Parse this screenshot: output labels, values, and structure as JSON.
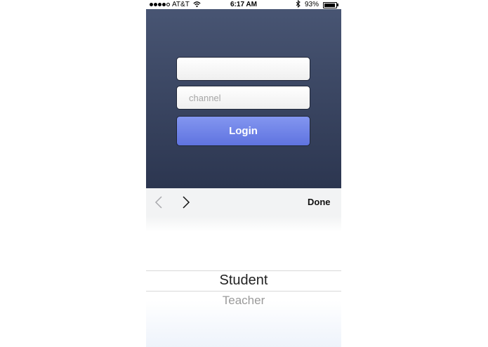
{
  "status_bar": {
    "carrier": "AT&T",
    "time": "6:17 AM",
    "battery": "93%",
    "battery_level": 0.93,
    "bluetooth_icon": "bluetooth-icon",
    "wifi_icon": "wifi-icon"
  },
  "login": {
    "username_value": "",
    "channel_placeholder": "channel",
    "login_label": "Login",
    "colors": {
      "background_top": "#485573",
      "background_bottom": "#2c3650",
      "button_top": "#8396f0",
      "button_bottom": "#5f73e0"
    }
  },
  "toolbar": {
    "prev_icon": "chevron-left-icon",
    "next_icon": "chevron-right-icon",
    "done_label": "Done"
  },
  "picker": {
    "selected": "Student",
    "options": [
      "Student",
      "Teacher"
    ]
  }
}
